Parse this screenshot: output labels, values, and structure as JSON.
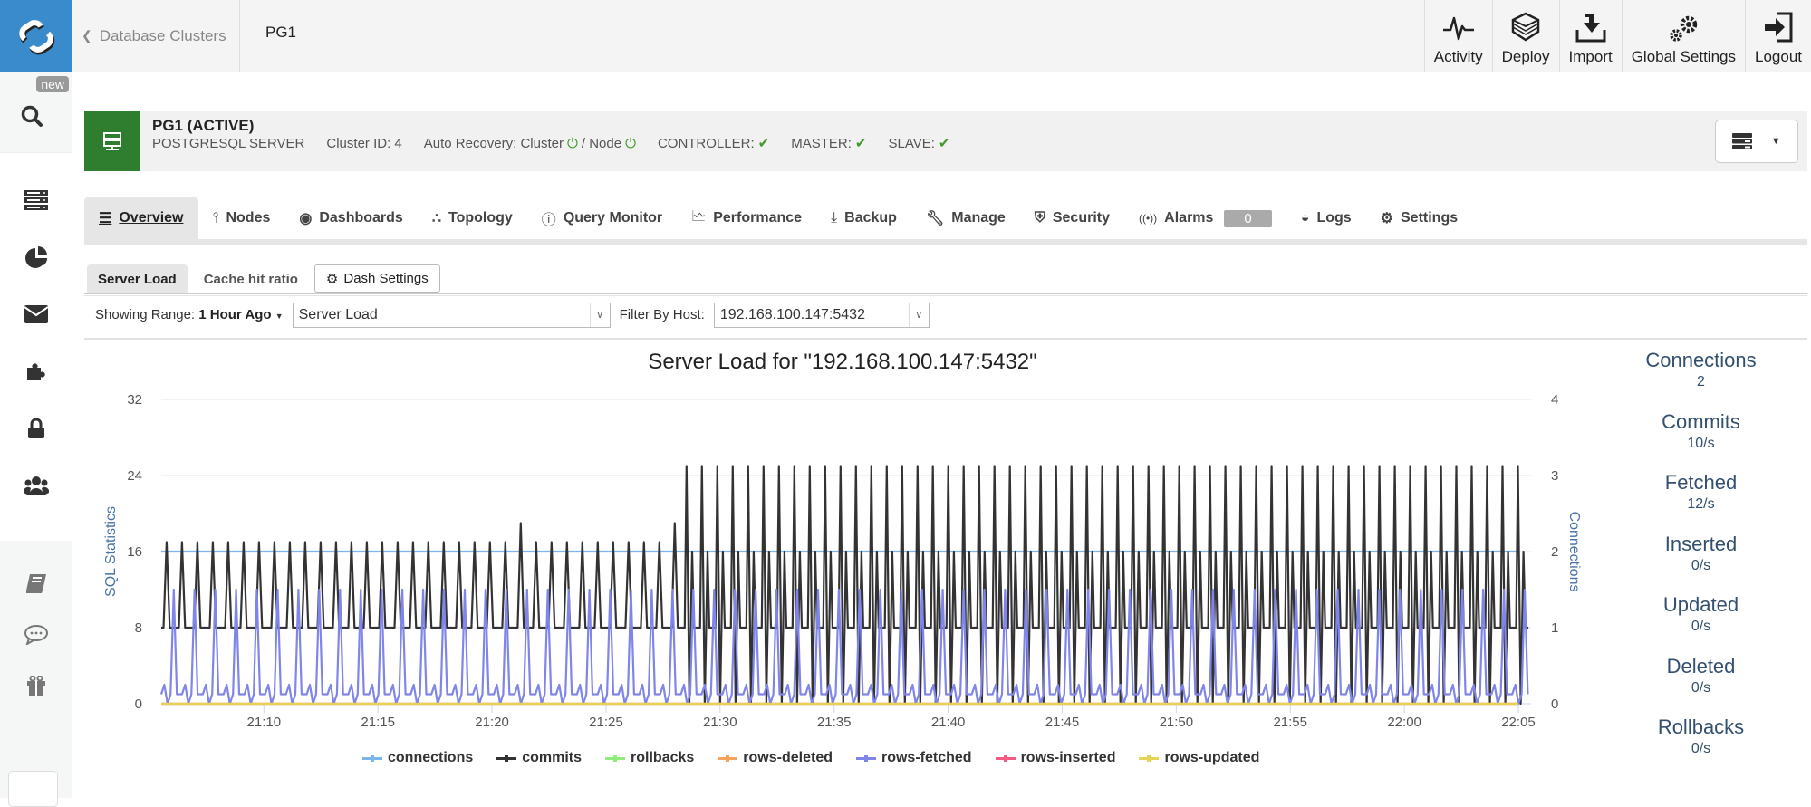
{
  "sidebar": {
    "new_badge": "new",
    "items": [
      "search-icon",
      "servers-icon",
      "pie-chart-icon",
      "envelope-icon",
      "puzzle-icon",
      "lock-icon",
      "users-icon"
    ],
    "bottom_items": [
      "book-icon",
      "chat-icon",
      "gift-icon"
    ]
  },
  "topbar": {
    "back_label": "Database Clusters",
    "current": "PG1",
    "actions": [
      {
        "label": "Activity",
        "icon": "activity-icon"
      },
      {
        "label": "Deploy",
        "icon": "layers-icon"
      },
      {
        "label": "Import",
        "icon": "import-icon"
      },
      {
        "label": "Global Settings",
        "icon": "gears-icon"
      },
      {
        "label": "Logout",
        "icon": "logout-icon"
      }
    ]
  },
  "cluster": {
    "name": "PG1 (ACTIVE)",
    "type": "POSTGRESQL SERVER",
    "cluster_id": "Cluster ID: 4",
    "auto_recovery": "Auto Recovery: Cluster",
    "node_label": "/ Node",
    "controller": "CONTROLLER:",
    "master": "MASTER:",
    "slave": "SLAVE:",
    "status_color": "#3e9a2a"
  },
  "tabs": [
    {
      "label": "Overview",
      "icon": "list-icon",
      "active": true
    },
    {
      "label": "Nodes",
      "icon": "sitemap-icon"
    },
    {
      "label": "Dashboards",
      "icon": "dashboard-icon"
    },
    {
      "label": "Topology",
      "icon": "topology-icon"
    },
    {
      "label": "Query Monitor",
      "icon": "gauge-icon"
    },
    {
      "label": "Performance",
      "icon": "line-chart-icon"
    },
    {
      "label": "Backup",
      "icon": "download-icon"
    },
    {
      "label": "Manage",
      "icon": "wrench-icon"
    },
    {
      "label": "Security",
      "icon": "shield-icon"
    },
    {
      "label": "Alarms",
      "icon": "broadcast-icon",
      "badge": "0"
    },
    {
      "label": "Logs",
      "icon": "inbox-icon"
    },
    {
      "label": "Settings",
      "icon": "gear-icon"
    }
  ],
  "subtabs": {
    "server_load": "Server Load",
    "cache_hit": "Cache hit ratio",
    "dash_settings": "Dash Settings"
  },
  "filters": {
    "range_label": "Showing Range:",
    "range_value": "1 Hour Ago",
    "dashboard_select": "Server Load",
    "host_label": "Filter By Host:",
    "host_select": "192.168.100.147:5432"
  },
  "stats": [
    {
      "label": "Connections",
      "value": "2"
    },
    {
      "label": "Commits",
      "value": "10/s"
    },
    {
      "label": "Fetched",
      "value": "12/s"
    },
    {
      "label": "Inserted",
      "value": "0/s"
    },
    {
      "label": "Updated",
      "value": "0/s"
    },
    {
      "label": "Deleted",
      "value": "0/s"
    },
    {
      "label": "Rollbacks",
      "value": "0/s"
    }
  ],
  "chart_data": {
    "type": "line",
    "title": "Server Load for \"192.168.100.147:5432\"",
    "ylabel": "SQL Statistics",
    "y2label": "Connections",
    "ylim": [
      0,
      32
    ],
    "y2lim": [
      0,
      4
    ],
    "yticks": [
      "0",
      "8",
      "16",
      "24",
      "32"
    ],
    "y2ticks": [
      "0",
      "1",
      "2",
      "3",
      "4"
    ],
    "xlim": [
      "21:05:30",
      "22:05"
    ],
    "xticks": [
      "21:10",
      "21:15",
      "21:20",
      "21:25",
      "21:30",
      "21:35",
      "21:40",
      "21:45",
      "21:50",
      "21:55",
      "22:00",
      "22:05"
    ],
    "grid": true,
    "legend_position": "bottom",
    "series": [
      {
        "name": "connections",
        "color": "#7cb5ec",
        "axis": "right",
        "pattern": "constant",
        "value": 2
      },
      {
        "name": "commits",
        "color": "#333333",
        "axis": "left",
        "pattern": "periodic",
        "baseline": 8,
        "peak_before_21_28": 17,
        "peak_after_21_28": 25,
        "secondary_peak_after": 16,
        "trough_after": 0
      },
      {
        "name": "rollbacks",
        "color": "#90ed7d",
        "axis": "left",
        "pattern": "constant",
        "value": 0
      },
      {
        "name": "rows-deleted",
        "color": "#f7a35c",
        "axis": "left",
        "pattern": "constant",
        "value": 0
      },
      {
        "name": "rows-fetched",
        "color": "#8085e9",
        "axis": "left",
        "pattern": "periodic",
        "baseline": 1,
        "peak": 12,
        "minor_peak": 2
      },
      {
        "name": "rows-inserted",
        "color": "#f15c80",
        "axis": "left",
        "pattern": "constant",
        "value": 0
      },
      {
        "name": "rows-updated",
        "color": "#e4d354",
        "axis": "left",
        "pattern": "constant",
        "value": 0
      }
    ]
  }
}
